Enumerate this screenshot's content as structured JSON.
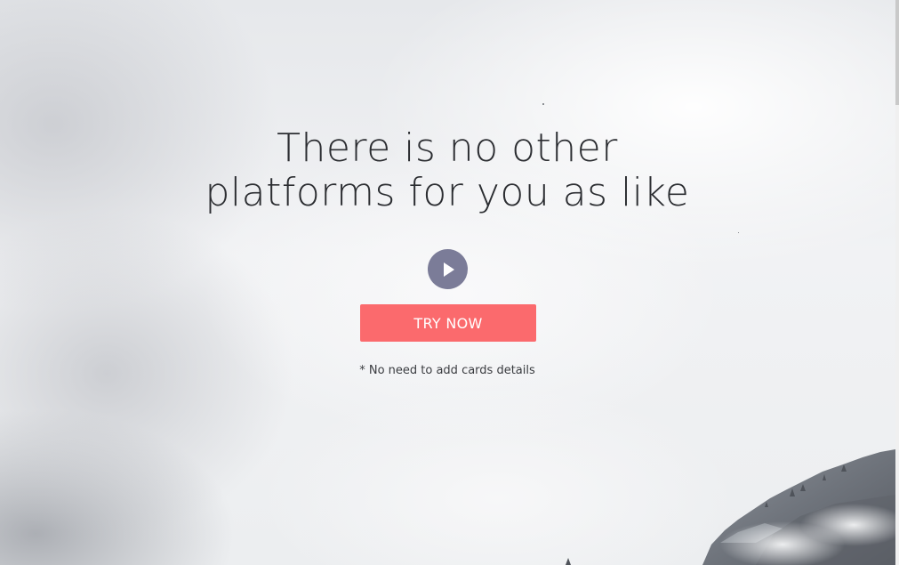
{
  "hero": {
    "headline_line1": "There is no other",
    "headline_line2": "platforms for you as like",
    "play_icon": "play-icon",
    "cta_label": "TRY NOW",
    "note": "* No need to add cards details"
  },
  "colors": {
    "cta_background": "#fb6a6d",
    "play_button_background": "#7b7c98",
    "headline_text": "#2b2d31"
  }
}
